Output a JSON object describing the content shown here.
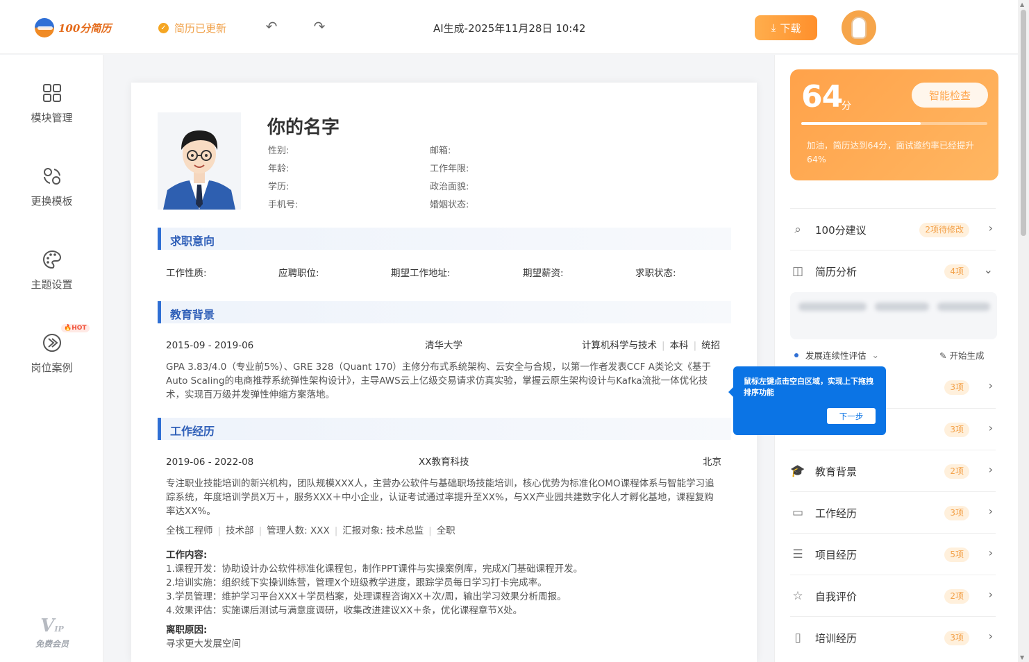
{
  "header": {
    "logo_text": "100分简历",
    "saved_status": "简历已更新",
    "doc_title": "AI生成-2025年11月28日 10:42",
    "download_label": "下载"
  },
  "sidebar": {
    "items": [
      {
        "label": "模块管理",
        "icon": "grid-icon"
      },
      {
        "label": "更换模板",
        "icon": "swap-template-icon"
      },
      {
        "label": "主题设置",
        "icon": "palette-icon"
      },
      {
        "label": "岗位案例",
        "icon": "case-icon",
        "badge": "HOT"
      }
    ],
    "vip_mark": "V",
    "vip_sub": "IP",
    "vip_label": "免费会员"
  },
  "resume": {
    "name": "你的名字",
    "fields_left": [
      "性别:",
      "年龄:",
      "学历:",
      "手机号:"
    ],
    "fields_right": [
      "邮箱:",
      "工作年限:",
      "政治面貌:",
      "婚姻状态:"
    ],
    "job_intent": {
      "title": "求职意向",
      "fields": [
        "工作性质:",
        "应聘职位:",
        "期望工作地址:",
        "期望薪资:",
        "求职状态:"
      ]
    },
    "education": {
      "title": "教育背景",
      "period": "2015-09 - 2019-06",
      "school": "清华大学",
      "major": "计算机科学与技术",
      "degree": "本科",
      "type": "统招",
      "description": "GPA 3.83/4.0（专业前5%）、GRE 328（Quant 170）主修分布式系统架构、云安全与合规，以第一作者发表CCF A类论文《基于Auto Scaling的电商推荐系统弹性架构设计》，主导AWS云上亿级交易请求仿真实验，掌握云原生架构设计与Kafka流批一体优化技术，实现百万级并发弹性伸缩方案落地。"
    },
    "work": {
      "title": "工作经历",
      "period": "2019-06 - 2022-08",
      "company": "XX教育科技",
      "city": "北京",
      "description": "专注职业技能培训的新兴机构，团队规模XXX人，主营办公软件与基础职场技能培训，核心优势为标准化OMO课程体系与智能学习追踪系统，年度培训学员X万＋，服务XXX＋中小企业，认证考试通过率提升至XX%，与XX产业园共建数字化人才孵化基地，课程复购率达XX%。",
      "tags": [
        "全栈工程师",
        "技术部",
        "管理人数: XXX",
        "汇报对象: 技术总监",
        "全职"
      ],
      "content_title": "工作内容:",
      "content": [
        "1.课程开发：协助设计办公软件标准化课程包，制作PPT课件与实操案例库，完成X门基础课程开发。",
        "2.培训实施：组织线下实操训练营，管理X个班级教学进度，跟踪学员每日学习打卡完成率。",
        "3.学员管理：维护学习平台XXX＋学员档案，处理课程咨询XX＋次/周，输出学习效果分析周报。",
        "4.效果评估：实施课后测试与满意度调研，收集改进建议XX＋条，优化课程章节X处。"
      ],
      "leave_title": "离职原因:",
      "leave_reason": "寻求更大发展空间"
    }
  },
  "score_panel": {
    "score": "64",
    "unit": "分",
    "progress": 0.64,
    "check_label": "智能检查",
    "tip": "加油，简历达到64分，面试邀约率已经提升64%"
  },
  "suggestions": [
    {
      "label": "100分建议",
      "badge": "2项待修改",
      "icon": "search-icon",
      "arrow": "›"
    },
    {
      "label": "简历分析",
      "badge": "4项",
      "icon": "chart-icon",
      "arrow": "⌄"
    },
    {
      "label": "",
      "badge": "3项",
      "icon": "",
      "arrow": "›"
    },
    {
      "label": "",
      "badge": "3项",
      "icon": "",
      "arrow": "›"
    },
    {
      "label": "教育背景",
      "badge": "2项",
      "icon": "graduation-cap-icon",
      "arrow": "›"
    },
    {
      "label": "工作经历",
      "badge": "3项",
      "icon": "monitor-icon",
      "arrow": "›"
    },
    {
      "label": "项目经历",
      "badge": "5项",
      "icon": "list-icon",
      "arrow": "›"
    },
    {
      "label": "自我评价",
      "badge": "2项",
      "icon": "star-icon",
      "arrow": "›"
    },
    {
      "label": "培训经历",
      "badge": "3项",
      "icon": "book-icon",
      "arrow": "›"
    }
  ],
  "analysis": {
    "eval_label": "发展连续性评估",
    "generate_label": "开始生成"
  },
  "tooltip": {
    "text": "鼠标左键点击空白区域，实现上下拖拽排序功能",
    "next_label": "下一步"
  },
  "colors": {
    "accent": "#ff9a3c",
    "primary": "#2f6fd4",
    "tooltip": "#0b74e5"
  }
}
